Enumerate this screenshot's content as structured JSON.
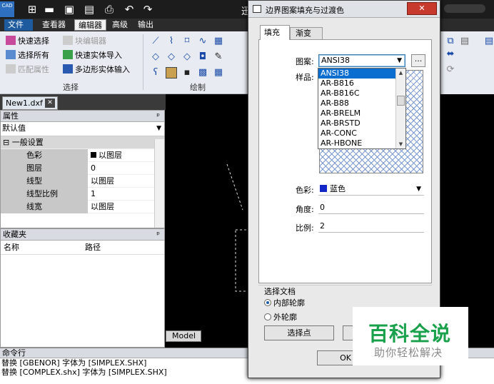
{
  "app": {
    "logo": "CAD",
    "title": "迅",
    "titlebar_icons": [
      "new-icon",
      "open-icon",
      "save-icon",
      "save-as-icon",
      "print-icon",
      "undo-icon",
      "redo-icon"
    ]
  },
  "menu": [
    "文件",
    "查看器",
    "编辑器",
    "高级",
    "输出"
  ],
  "ribbon": {
    "select_group": {
      "label": "选择",
      "items": [
        "快速选择",
        "选择所有",
        "匹配属性"
      ]
    },
    "entity_group": {
      "items": [
        "块编辑器",
        "快速实体导入",
        "多边形实体输入"
      ]
    },
    "draw_group": {
      "label": "绘制"
    }
  },
  "doc_tab": {
    "name": "New1.dxf"
  },
  "properties": {
    "header": "属性",
    "default_value": "默认值",
    "section": "一般设置",
    "rows": [
      {
        "name": "色彩",
        "value": "以图层"
      },
      {
        "name": "图层",
        "value": "0"
      },
      {
        "name": "线型",
        "value": "以图层"
      },
      {
        "name": "线型比例",
        "value": "1"
      },
      {
        "name": "线宽",
        "value": "以图层"
      }
    ]
  },
  "favorites": {
    "header": "收藏夹",
    "col_name": "名称",
    "col_path": "路径"
  },
  "model_tab": "Model",
  "command": {
    "header": "命令行",
    "lines": [
      "替换 [GBENOR] 字体为 [SIMPLEX.SHX]",
      "替换 [COMPLEX.shx] 字体为 [SIMPLEX.SHX]"
    ]
  },
  "dialog": {
    "title": "边界图案填充与过渡色",
    "tab_fill": "填充",
    "tab_gradient": "渐变",
    "pattern_label": "图案:",
    "pattern_value": "ANSI38",
    "ellipsis": "...",
    "sample_label": "样品:",
    "pattern_options": [
      "ANSI38",
      "AR-B816",
      "AR-B816C",
      "AR-B88",
      "AR-BRELM",
      "AR-BRSTD",
      "AR-CONC",
      "AR-HBONE"
    ],
    "color_label": "色彩:",
    "color_value": "蓝色",
    "color_hex": "#1427c8",
    "angle_label": "角度:",
    "angle_value": "0",
    "scale_label": "比例:",
    "scale_value": "2",
    "boundary_group": "选择文档",
    "radio_inner": "内部轮廓",
    "radio_outer": "外轮廓",
    "pick_points": "选择点",
    "ok": "OK"
  },
  "watermark": {
    "title": "百科全说",
    "subtitle": "助你轻松解决"
  }
}
